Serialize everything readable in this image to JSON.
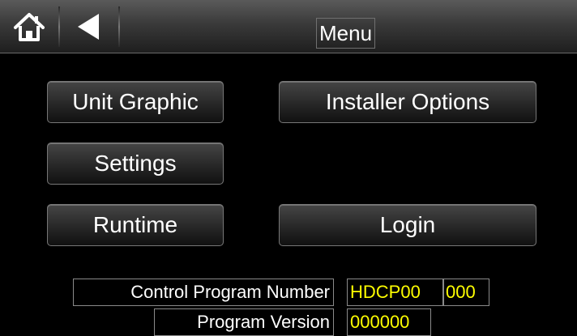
{
  "header": {
    "title": "Menu",
    "home_icon": "home-icon",
    "back_icon": "back-arrow-icon"
  },
  "menu": {
    "unit_graphic": "Unit Graphic",
    "installer_options": "Installer Options",
    "settings": "Settings",
    "runtime": "Runtime",
    "login": "Login"
  },
  "info": {
    "control_program_number_label": "Control Program Number",
    "control_program_number_prefix": "HDCP00",
    "control_program_number_suffix": "000",
    "program_version_label": "Program Version",
    "program_version_value": "000000"
  },
  "colors": {
    "background": "#000000",
    "value_text": "#ffff00",
    "label_text": "#ffffff"
  }
}
